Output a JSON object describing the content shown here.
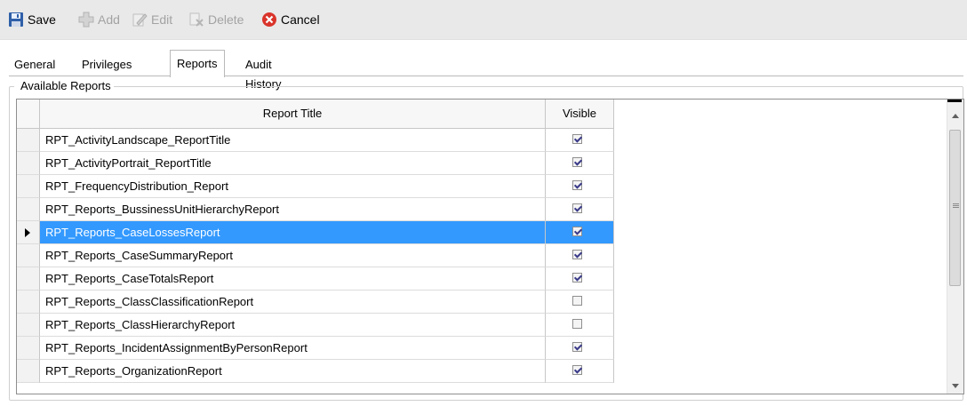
{
  "toolbar": {
    "save_label": "Save",
    "add_label": "Add",
    "edit_label": "Edit",
    "delete_label": "Delete",
    "cancel_label": "Cancel"
  },
  "tabs": [
    {
      "label": "General"
    },
    {
      "label": "Privileges"
    },
    {
      "label": "Reports"
    },
    {
      "label": "Audit History"
    }
  ],
  "active_tab": "Reports",
  "group": {
    "legend": "Available Reports"
  },
  "grid": {
    "columns": [
      "Report Title",
      "Visible"
    ],
    "rows": [
      {
        "title": "RPT_ActivityLandscape_ReportTitle",
        "visible": true
      },
      {
        "title": "RPT_ActivityPortrait_ReportTitle",
        "visible": true
      },
      {
        "title": "RPT_FrequencyDistribution_Report",
        "visible": true
      },
      {
        "title": "RPT_Reports_BussinessUnitHierarchyReport",
        "visible": true
      },
      {
        "title": "RPT_Reports_CaseLossesReport",
        "visible": true,
        "selected": true
      },
      {
        "title": "RPT_Reports_CaseSummaryReport",
        "visible": true
      },
      {
        "title": "RPT_Reports_CaseTotalsReport",
        "visible": true
      },
      {
        "title": "RPT_Reports_ClassClassificationReport",
        "visible": false
      },
      {
        "title": "RPT_Reports_ClassHierarchyReport",
        "visible": false
      },
      {
        "title": "RPT_Reports_IncidentAssignmentByPersonReport",
        "visible": true
      },
      {
        "title": "RPT_Reports_OrganizationReport",
        "visible": true
      }
    ]
  },
  "colors": {
    "selection": "#3399ff",
    "toolbar_bg": "#e9e9e9",
    "cancel_red": "#d9342b"
  }
}
